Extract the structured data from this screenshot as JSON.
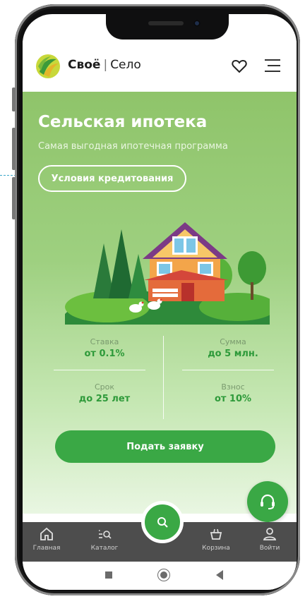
{
  "header": {
    "brand_bold": "Своё",
    "brand_sep": "|",
    "brand_rest": "Село"
  },
  "hero": {
    "title": "Сельская ипотека",
    "subtitle": "Самая выгодная ипотечная программа",
    "conditions_button": "Условия кредитования"
  },
  "stats": {
    "rate_label": "Ставка",
    "rate_value": "от 0.1%",
    "sum_label": "Сумма",
    "sum_value": "до 5 млн.",
    "term_label": "Срок",
    "term_value": "до 25 лет",
    "fee_label": "Взнос",
    "fee_value": "от 10%"
  },
  "apply_button": "Подать заявку",
  "tabbar": {
    "items": [
      {
        "label": "Главная",
        "icon": "home-icon"
      },
      {
        "label": "Каталог",
        "icon": "catalog-search-icon"
      },
      {
        "label": "Корзина",
        "icon": "basket-icon"
      },
      {
        "label": "Войти",
        "icon": "user-icon"
      }
    ]
  },
  "colors": {
    "accent": "#3aa845",
    "hero_top": "#8fc46a",
    "tabbar": "#4d4d4d"
  }
}
